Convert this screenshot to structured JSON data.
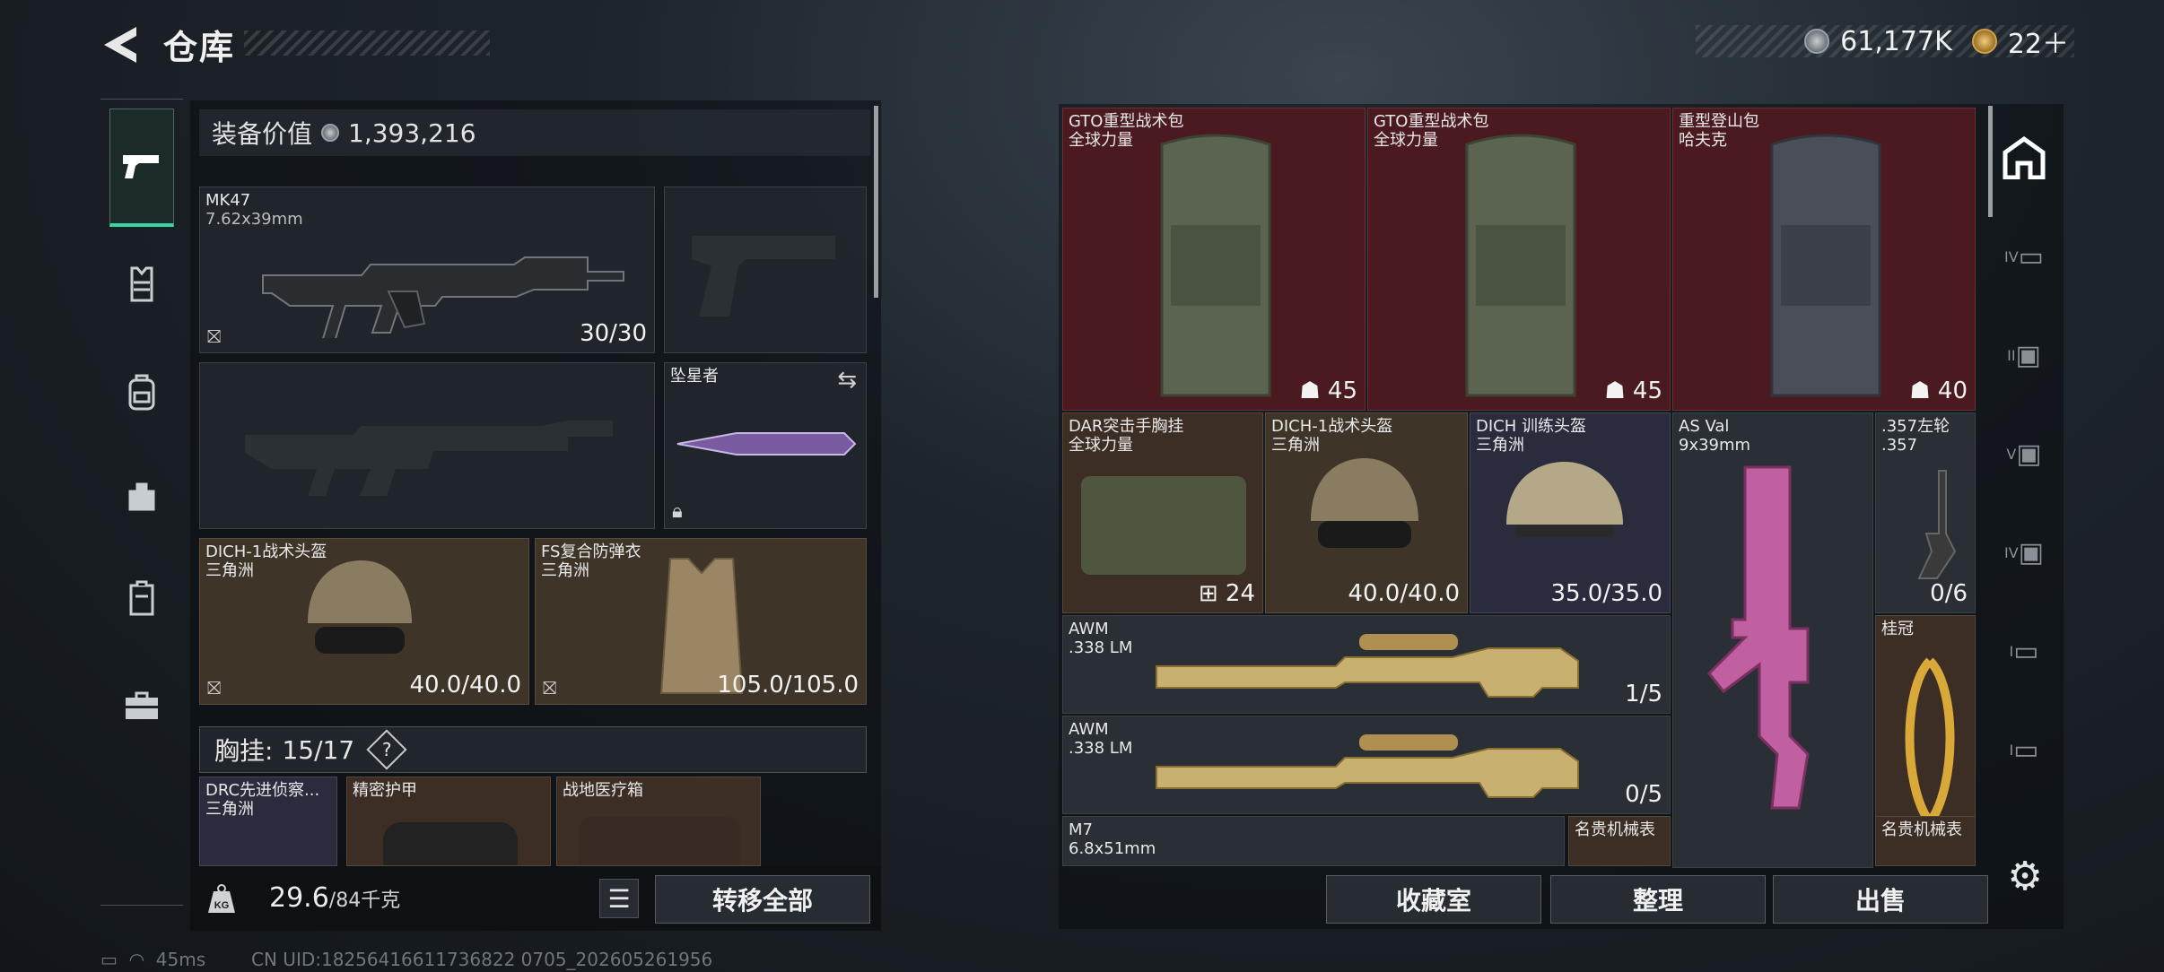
{
  "header": {
    "title": "仓库",
    "currency_silver": "61,177K",
    "currency_gold": "22＋"
  },
  "left_tabs": [
    {
      "name": "weapons",
      "icon": "pistol-icon",
      "active": true
    },
    {
      "name": "armor",
      "icon": "vest-icon"
    },
    {
      "name": "backpack",
      "icon": "backpack-icon"
    },
    {
      "name": "bag",
      "icon": "bag-icon"
    },
    {
      "name": "container",
      "icon": "container-icon"
    },
    {
      "name": "case",
      "icon": "toolbox-icon"
    }
  ],
  "loadout": {
    "equipment_value_label": "装备价值",
    "equipment_value": "1,393,216",
    "primary": {
      "name": "MK47",
      "caliber": "7.62x39mm",
      "ammo": "30/30"
    },
    "melee": {
      "name": "坠星者"
    },
    "helmet": {
      "name": "DICH-1战术头盔",
      "faction": "三角洲",
      "durability": "40.0/40.0"
    },
    "armor": {
      "name": "FS复合防弹衣",
      "faction": "三角洲",
      "durability": "105.0/105.0"
    },
    "chest_rig": {
      "label": "胸挂:",
      "capacity": "15/17",
      "help": "?"
    },
    "chest_items": [
      {
        "name": "DRC先进侦察...",
        "faction": "三角洲"
      },
      {
        "name": "精密护甲"
      },
      {
        "name": "战地医疗箱"
      }
    ],
    "weight": "29.6",
    "weight_max": "/84千克",
    "transfer_all": "转移全部"
  },
  "storage": {
    "items": [
      {
        "name": "GTO重型战术包",
        "sub": "全球力量",
        "count": "45"
      },
      {
        "name": "GTO重型战术包",
        "sub": "全球力量",
        "count": "45"
      },
      {
        "name": "重型登山包",
        "sub": "哈夫克",
        "count": "40"
      },
      {
        "name": "DAR突击手胸挂",
        "sub": "全球力量",
        "count": "24"
      },
      {
        "name": "DICH-1战术头盔",
        "sub": "三角洲",
        "count": "40.0/40.0"
      },
      {
        "name": "DICH 训练头盔",
        "sub": "三角洲",
        "count": "35.0/35.0"
      },
      {
        "name": "AS Val",
        "sub": "9x39mm"
      },
      {
        "name": ".357左轮",
        "sub": ".357",
        "count": "0/6"
      },
      {
        "name": "AWM",
        "sub": ".338 LM",
        "count": "1/5"
      },
      {
        "name": "桂冠"
      },
      {
        "name": "AWM",
        "sub": ".338 LM",
        "count": "0/5"
      },
      {
        "name": "M7",
        "sub": "6.8x51mm"
      },
      {
        "name": "名贵机械表"
      },
      {
        "name": "名贵机械表"
      }
    ],
    "buttons": {
      "collection": "收藏室",
      "sort": "整理",
      "sell": "出售"
    }
  },
  "right_tabs": [
    "home-icon",
    "IV",
    "II",
    "V",
    "IV",
    "I",
    "I"
  ],
  "status_bar": {
    "ping": "45ms",
    "uid": "CN UID:18256416611736822 0705_202605261956"
  },
  "colors": {
    "accent": "#36d6a0",
    "maroon": "#4a1a20",
    "brown": "#3e3528"
  }
}
